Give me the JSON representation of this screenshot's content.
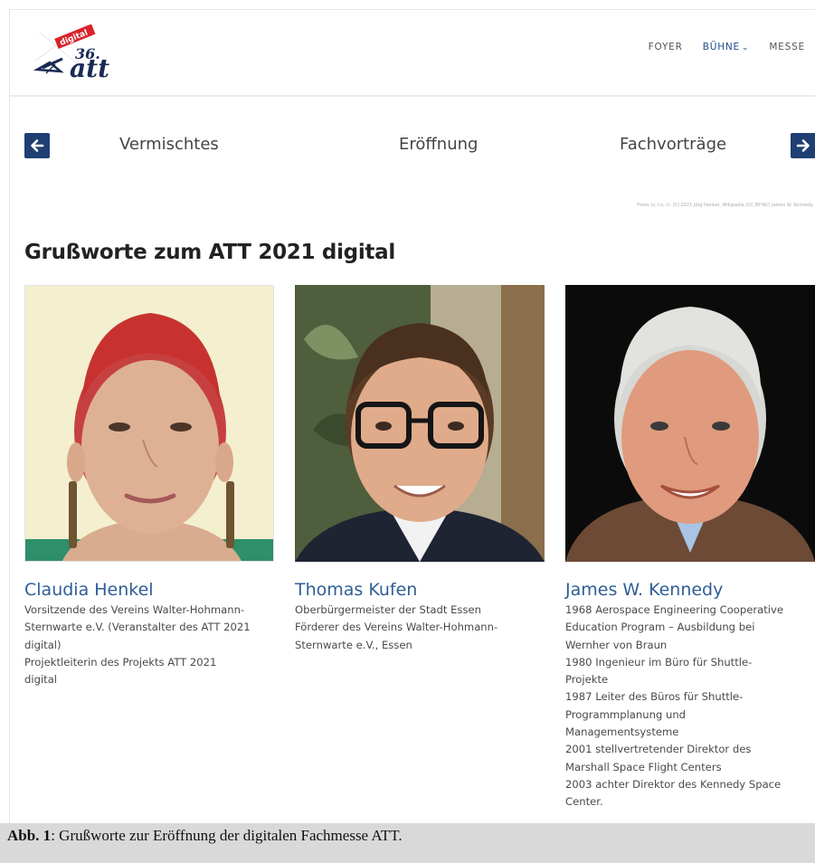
{
  "nav": {
    "items": [
      {
        "label": "FOYER"
      },
      {
        "label": "BÜHNE",
        "chevron": "⌄"
      },
      {
        "label": "MESSE"
      }
    ]
  },
  "logo": {
    "badge": "digital",
    "number": "36.",
    "wordmark": "att"
  },
  "slider": {
    "prev": "Vermischtes",
    "current": "Eröffnung",
    "next": "Fachvorträge"
  },
  "credit": "Fotos (v. l.n. r): (C) 2021 Jörg Henkel, Wikipedia (CC BY-NC) James W. Kennedy",
  "section_title": "Grußworte zum ATT 2021 digital",
  "people": [
    {
      "name": "Claudia Henkel",
      "lines": [
        "Vorsitzende des Vereins Walter-Hohmann-",
        "Sternwarte e.V. (Veranstalter des ATT 2021",
        "digital)",
        "Projektleiterin des Projekts ATT 2021",
        "digital"
      ]
    },
    {
      "name": "Thomas Kufen",
      "lines": [
        "Oberbürgermeister der Stadt Essen",
        "Förderer des Vereins Walter-Hohmann-",
        "Sternwarte e.V., Essen"
      ]
    },
    {
      "name": "James W. Kennedy",
      "lines": [
        "1968 Aerospace Engineering Cooperative",
        "Education Program – Ausbildung bei",
        "Wernher von Braun",
        "1980 Ingenieur im Büro für Shuttle-",
        "Projekte",
        "1987 Leiter des Büros für Shuttle-",
        "Programmplanung und",
        "Managementsysteme",
        "2001 stellvertretender Direktor des",
        "Marshall Space Flight Centers",
        "2003 achter Direktor des Kennedy Space",
        "Center."
      ]
    }
  ],
  "caption": {
    "label": "Abb. 1",
    "text": ": Grußworte zur Eröffnung der digitalen Fachmesse ATT."
  },
  "colors": {
    "accent": "#1f3f73",
    "link": "#2f5e96",
    "caption_bg": "#d9d9d9"
  },
  "icons": {
    "prev": "arrow-left-icon",
    "next": "arrow-right-icon"
  }
}
